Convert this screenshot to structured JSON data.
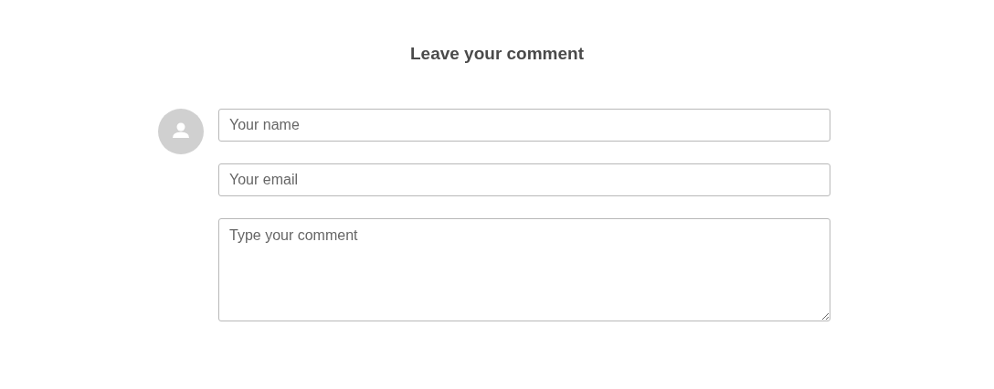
{
  "title": "Leave your comment",
  "fields": [
    {
      "kind": "input",
      "placeholder": "Your name"
    },
    {
      "kind": "input",
      "placeholder": "Your email"
    },
    {
      "kind": "textarea",
      "placeholder": "Type your comment"
    }
  ]
}
